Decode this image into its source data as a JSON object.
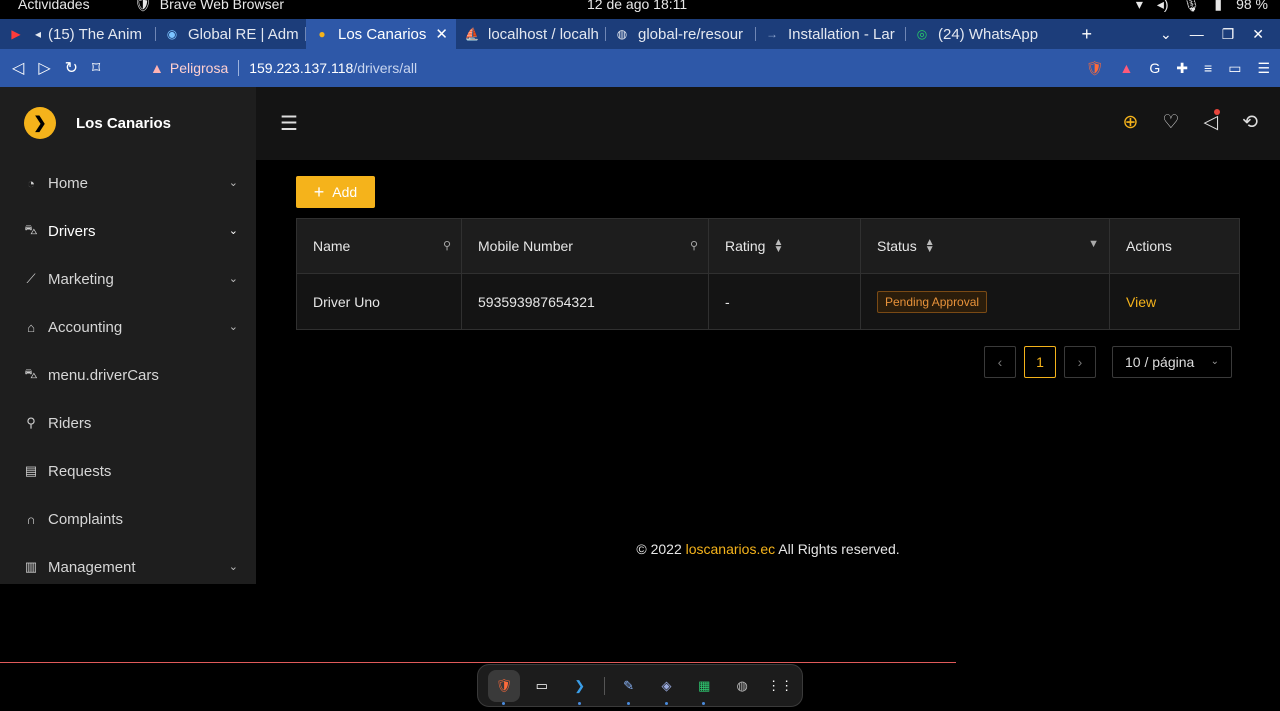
{
  "system": {
    "activities": "Actividades",
    "app_name": "Brave Web Browser",
    "clock": "12 de ago  18:11",
    "battery": "98 %"
  },
  "tabs": [
    {
      "label": "(15) The Anim",
      "icon": "youtube-icon",
      "active": false
    },
    {
      "label": "Global RE | Admi",
      "icon": "globe-icon",
      "active": false
    },
    {
      "label": "Los Canarios ·",
      "icon": "canarios-icon",
      "active": true
    },
    {
      "label": "localhost / localh",
      "icon": "phpmyadmin-icon",
      "active": false
    },
    {
      "label": "global-re/resour",
      "icon": "github-icon",
      "active": false
    },
    {
      "label": "Installation - Lar",
      "icon": "arrow-icon",
      "active": false
    },
    {
      "label": "(24) WhatsApp",
      "icon": "whatsapp-icon",
      "active": false
    }
  ],
  "address": {
    "warning": "Peligrosa",
    "host": "159.223.137.118",
    "path": "/drivers/all"
  },
  "brand": {
    "name": "Los Canarios"
  },
  "sidebar": {
    "items": [
      {
        "label": "Home",
        "icon": "dashboard-icon",
        "chevron": true
      },
      {
        "label": "Drivers",
        "icon": "car-icon",
        "chevron": true
      },
      {
        "label": "Marketing",
        "icon": "chart-icon",
        "chevron": true
      },
      {
        "label": "Accounting",
        "icon": "bank-icon",
        "chevron": true
      },
      {
        "label": "menu.driverCars",
        "icon": "car-icon",
        "chevron": false
      },
      {
        "label": "Riders",
        "icon": "user-icon",
        "chevron": false
      },
      {
        "label": "Requests",
        "icon": "list-icon",
        "chevron": false
      },
      {
        "label": "Complaints",
        "icon": "headset-icon",
        "chevron": false
      },
      {
        "label": "Management",
        "icon": "sliders-icon",
        "chevron": true
      }
    ]
  },
  "toolbar": {
    "add_label": "Add"
  },
  "table": {
    "headers": [
      "Name",
      "Mobile Number",
      "Rating",
      "Status",
      "Actions"
    ],
    "rows": [
      {
        "name": "Driver Uno",
        "mobile": "593593987654321",
        "rating": "-",
        "status": "Pending Approval",
        "action": "View"
      }
    ]
  },
  "pagination": {
    "current": "1",
    "page_size": "10 / página"
  },
  "footer": {
    "prefix": "© 2022 ",
    "link": "loscanarios.ec",
    "suffix": " All Rights reserved."
  },
  "colors": {
    "accent": "#f5b31b",
    "tabbar": "#1c3d7a",
    "sidebar": "#1e1e1e"
  }
}
